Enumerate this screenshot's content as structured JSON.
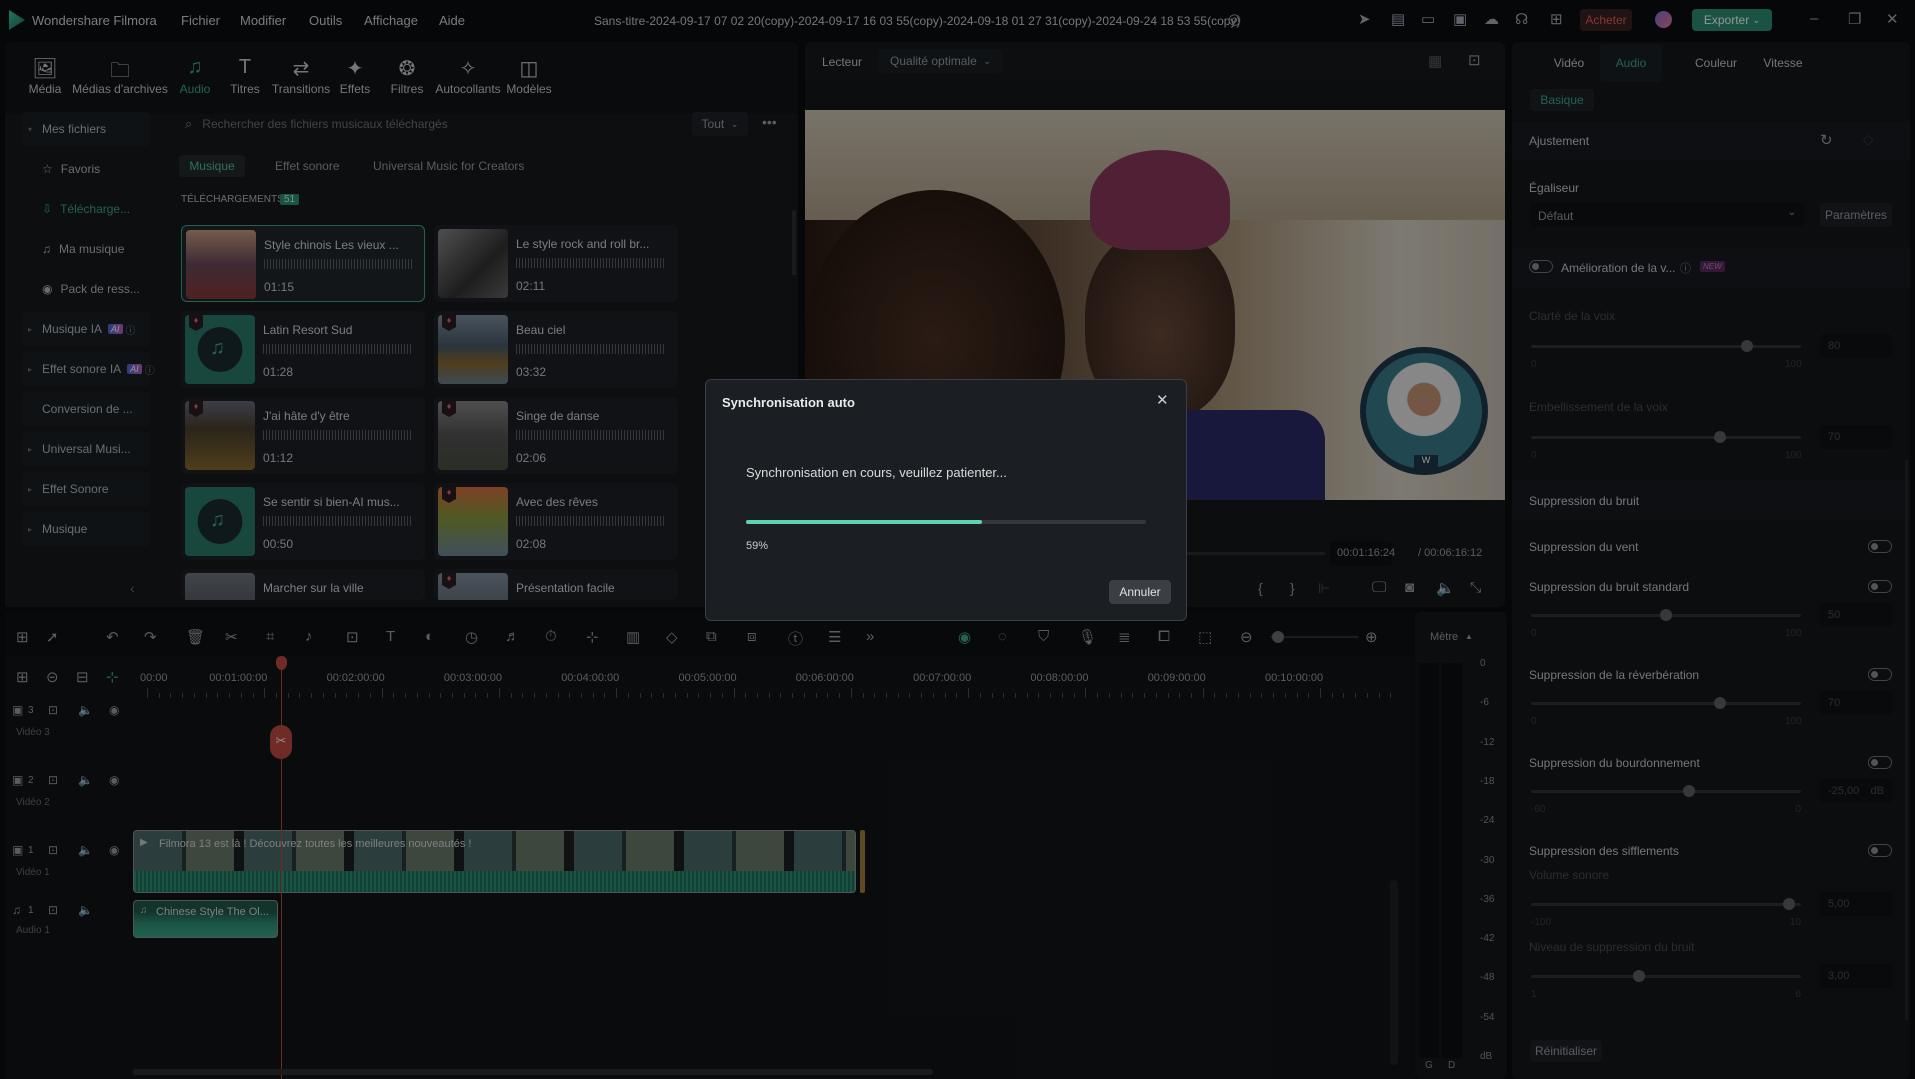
{
  "app": {
    "name": "Wondershare Filmora",
    "project_title": "Sans-titre-2024-09-17 07 02 20(copy)-2024-09-17 16 03 55(copy)-2024-09-18 01 27 31(copy)-2024-09-24 18 53 55(copy)"
  },
  "menu": [
    "Fichier",
    "Modifier",
    "Outils",
    "Affichage",
    "Aide"
  ],
  "titlebar": {
    "buy_label": "Acheter",
    "export_label": "Exporter",
    "accent": "#2fb38f",
    "buy_color": "#e0605a"
  },
  "nav_tabs": [
    {
      "label": "Média",
      "icon": "image-icon"
    },
    {
      "label": "Médias d'archives",
      "icon": "folder-icon"
    },
    {
      "label": "Audio",
      "icon": "music-note-icon",
      "active": true
    },
    {
      "label": "Titres",
      "icon": "text-icon"
    },
    {
      "label": "Transitions",
      "icon": "transition-icon"
    },
    {
      "label": "Effets",
      "icon": "sparkle-icon"
    },
    {
      "label": "Filtres",
      "icon": "filter-icon"
    },
    {
      "label": "Autocollants",
      "icon": "sticker-icon"
    },
    {
      "label": "Modèles",
      "icon": "template-icon"
    }
  ],
  "sidebar": {
    "items": [
      {
        "label": "Mes fichiers",
        "type": "group-open"
      },
      {
        "label": "Favoris",
        "icon": "star-icon"
      },
      {
        "label": "Télécharge...",
        "icon": "download-icon",
        "active": true
      },
      {
        "label": "Ma musique",
        "icon": "music-note-icon"
      },
      {
        "label": "Pack de ress...",
        "icon": "pack-icon"
      },
      {
        "label": "Musique IA",
        "type": "group",
        "badge": "AI"
      },
      {
        "label": "Effet sonore IA",
        "type": "group",
        "badge": "AI"
      },
      {
        "label": "Conversion de ...",
        "type": "group-plain"
      },
      {
        "label": "Universal Musi...",
        "type": "group"
      },
      {
        "label": "Effet Sonore",
        "type": "group"
      },
      {
        "label": "Musique",
        "type": "group"
      }
    ]
  },
  "library": {
    "search_placeholder": "Rechercher des fichiers musicaux téléchargés",
    "filter_value": "Tout",
    "sub_tabs": [
      "Musique",
      "Effet sonore",
      "Universal Music for Creators"
    ],
    "section_title": "TÉLÉCHARGEMENTS",
    "section_count": "51",
    "items": [
      {
        "name": "Style chinois Les vieux ...",
        "duration": "01:15",
        "thumb": "mountain",
        "selected": true
      },
      {
        "name": "Le style rock and roll br...",
        "duration": "02:11",
        "thumb": "rock"
      },
      {
        "name": "Latin Resort Sud",
        "duration": "01:28",
        "thumb": "note",
        "premium": true
      },
      {
        "name": "Beau ciel",
        "duration": "03:32",
        "thumb": "lake",
        "premium": true
      },
      {
        "name": "J'ai hâte d'y être",
        "duration": "01:12",
        "thumb": "field",
        "premium": true
      },
      {
        "name": "Singe de danse",
        "duration": "02:06",
        "thumb": "grey",
        "premium": true
      },
      {
        "name": "Se sentir si bien-AI mus...",
        "duration": "00:50",
        "thumb": "note"
      },
      {
        "name": "Avec des rêves",
        "duration": "02:08",
        "thumb": "sunset",
        "premium": true
      },
      {
        "name": "Marcher sur la ville",
        "duration": "",
        "thumb": "city"
      },
      {
        "name": "Présentation facile",
        "duration": "",
        "thumb": "river",
        "premium": true
      }
    ]
  },
  "player": {
    "label": "Lecteur",
    "quality": "Qualité optimale",
    "current_time": "00:01:16:24",
    "total_time": "/ 00:06:16:12"
  },
  "right_panel": {
    "tabs": [
      "Vidéo",
      "Audio",
      "Couleur",
      "Vitesse"
    ],
    "active_tab": "Audio",
    "sub_tab": "Basique",
    "adjustment": "Ajustement",
    "equalizer_label": "Égaliseur",
    "equalizer_value": "Défaut",
    "settings_button": "Paramètres",
    "voice_enhance": {
      "label": "Amélioration de la v...",
      "badge": "NEW",
      "on": false
    },
    "voice_clarity": {
      "label": "Clarté de la voix",
      "value": "80",
      "min": "0",
      "max": "100"
    },
    "voice_beauty": {
      "label": "Embellissement de la voix",
      "value": "70",
      "min": "0",
      "max": "100"
    },
    "noise_header": "Suppression du bruit",
    "wind": {
      "label": "Suppression du vent",
      "on": false
    },
    "standard": {
      "label": "Suppression du bruit standard",
      "on": false,
      "value": "50",
      "min": "0",
      "max": "100"
    },
    "reverb": {
      "label": "Suppression de la réverbération",
      "on": false,
      "value": "70",
      "min": "0",
      "max": "100"
    },
    "hum": {
      "label": "Suppression du bourdonnement",
      "on": false,
      "value": "-25,00",
      "unit": "dB",
      "min": "-60",
      "max": "0"
    },
    "hiss": {
      "label": "Suppression des sifflements",
      "on": false
    },
    "loudness": {
      "label": "Volume sonore",
      "value": "5,00",
      "min": "-100",
      "max": "10"
    },
    "noise_level": {
      "label": "Niveau de suppression du bruit",
      "value": "3,00",
      "min": "1",
      "max": "6"
    },
    "reset_button": "Réinitialiser"
  },
  "timeline": {
    "ruler": [
      "00:00",
      "00:01:00:00",
      "00:02:00:00",
      "00:03:00:00",
      "00:04:00:00",
      "00:05:00:00",
      "00:06:00:00",
      "00:07:00:00",
      "00:08:00:00",
      "00:09:00:00",
      "00:10:00:00"
    ],
    "tracks": [
      {
        "num": "3",
        "name": "Vidéo 3",
        "type": "video"
      },
      {
        "num": "2",
        "name": "Vidéo 2",
        "type": "video"
      },
      {
        "num": "1",
        "name": "Vidéo 1",
        "type": "video"
      },
      {
        "num": "1",
        "name": "Audio 1",
        "type": "audio"
      }
    ],
    "video_clip_title": "Filmora 13 est là ! Découvrez toutes les meilleures nouveautés !",
    "audio_clip_title": "Chinese Style The Ol...",
    "playhead_time": "00:01:16:24"
  },
  "meter": {
    "label": "Mètre",
    "scale": [
      "0",
      "-6",
      "-12",
      "-18",
      "-24",
      "-30",
      "-36",
      "-42",
      "-48",
      "-54",
      "dB"
    ],
    "channels": [
      "G",
      "D"
    ]
  },
  "dialog": {
    "title": "Synchronisation auto",
    "message": "Synchronisation en cours, veuillez patienter...",
    "progress_percent": 59,
    "progress_label": "59%",
    "cancel_button": "Annuler",
    "progress_color": "#5ed3b3"
  }
}
